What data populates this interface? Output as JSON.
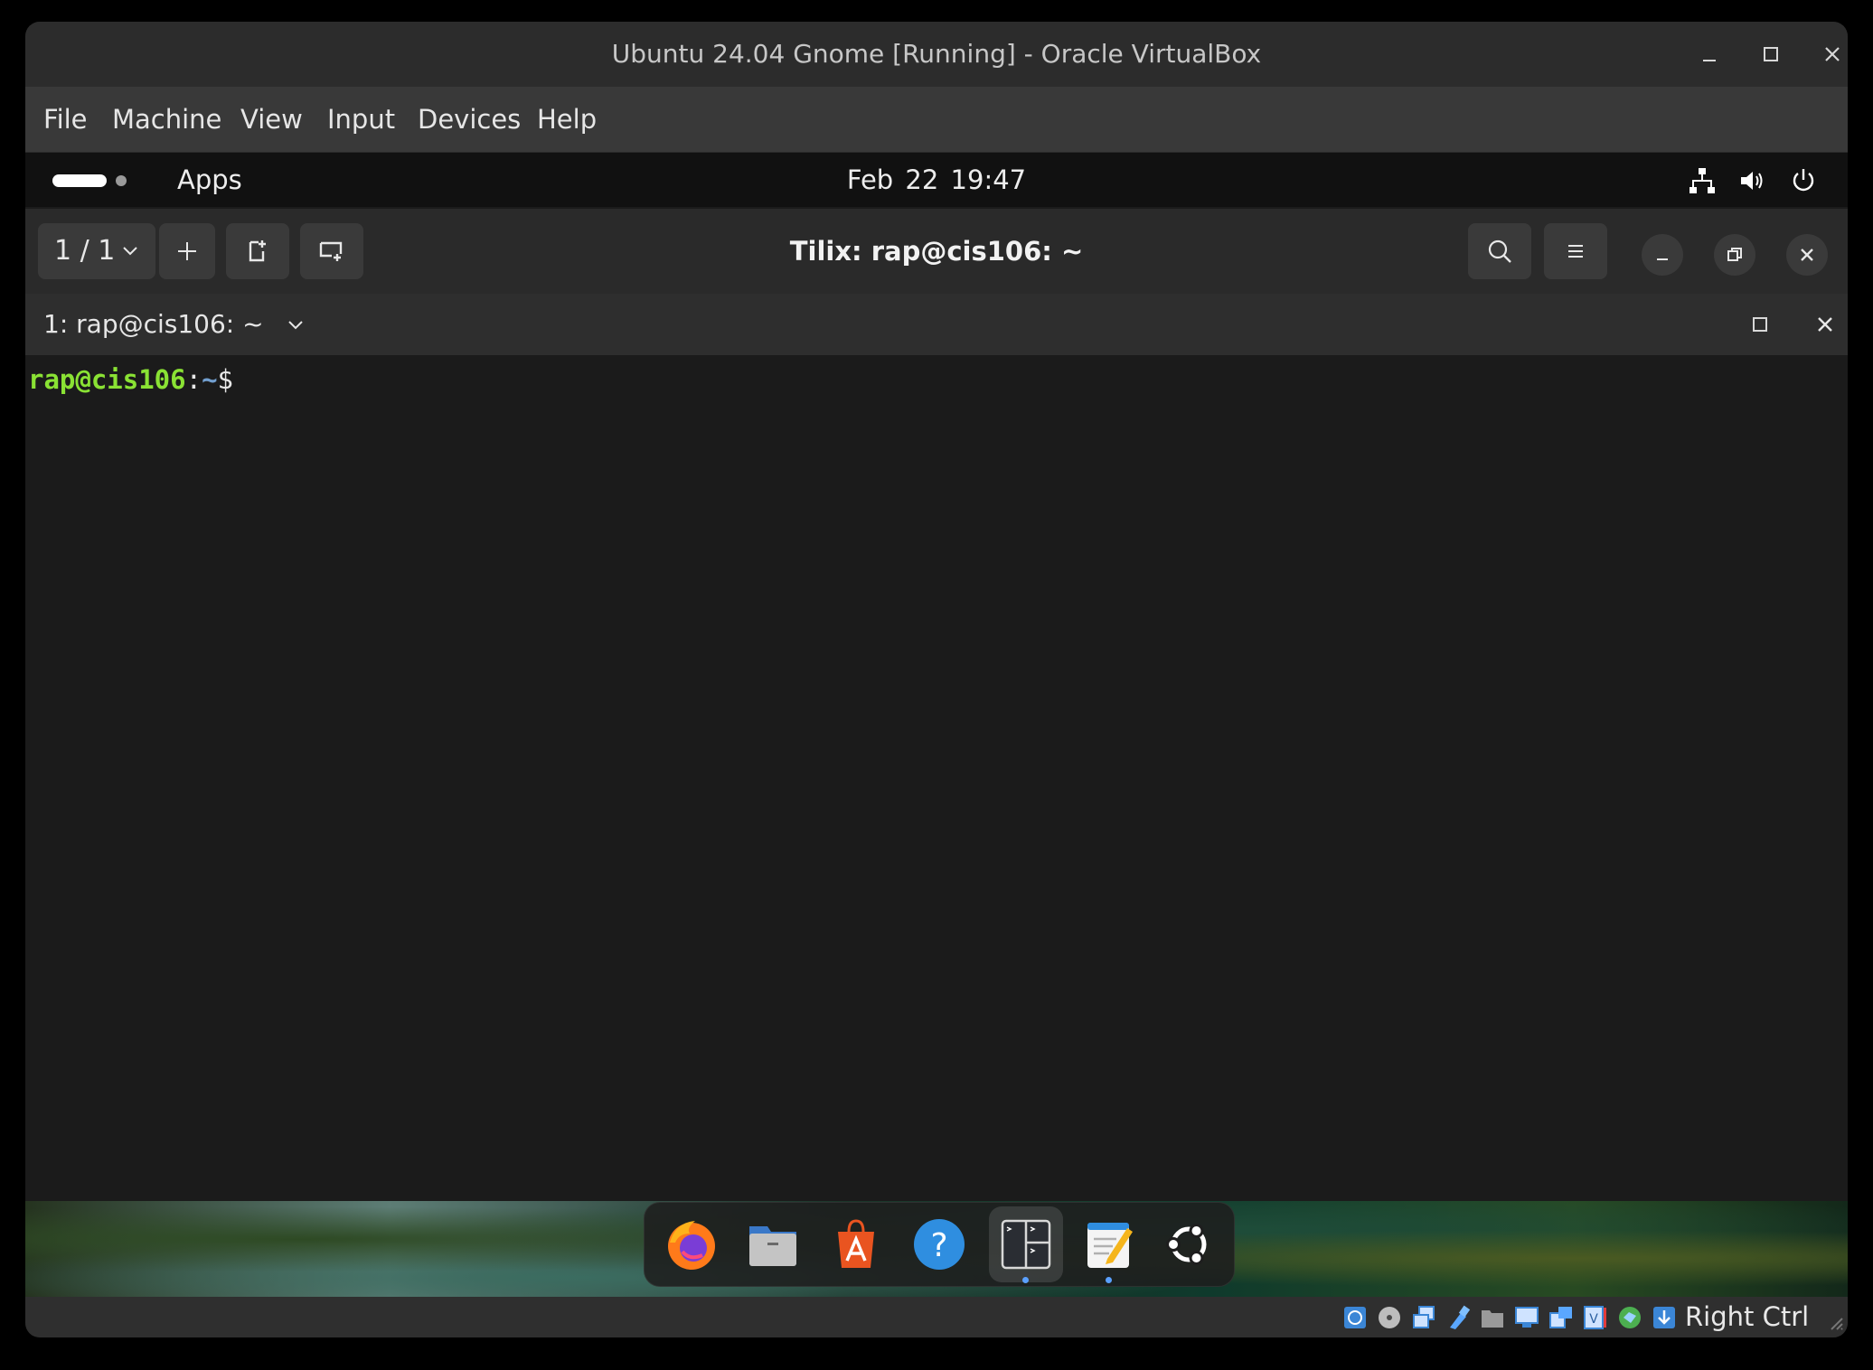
{
  "window": {
    "title": "Ubuntu 24.04 Gnome [Running] - Oracle VirtualBox"
  },
  "menubar": {
    "items": [
      "File",
      "Machine",
      "View",
      "Input",
      "Devices",
      "Help"
    ]
  },
  "gnome_topbar": {
    "apps_label": "Apps",
    "clock": "Feb 22  19:47",
    "tray_icons": [
      "network-icon",
      "volume-icon",
      "power-icon"
    ]
  },
  "tilix": {
    "session_indicator": "1 / 1",
    "title": "Tilix: rap@cis106: ~",
    "terminal_tab_label": "1: rap@cis106: ~"
  },
  "terminal": {
    "prompt_user": "rap@cis106",
    "prompt_colon": ":",
    "prompt_path": "~",
    "prompt_symbol": "$"
  },
  "dock": {
    "apps": [
      "firefox-icon",
      "files-icon",
      "app-center-icon",
      "help-icon",
      "tilix-icon",
      "text-editor-icon",
      "ubuntu-icon"
    ]
  },
  "statusbar": {
    "host_key": "Right Ctrl"
  },
  "colors": {
    "prompt_user": "#8ae234",
    "prompt_path": "#729fcf",
    "terminal_bg": "#1b1b1b"
  }
}
